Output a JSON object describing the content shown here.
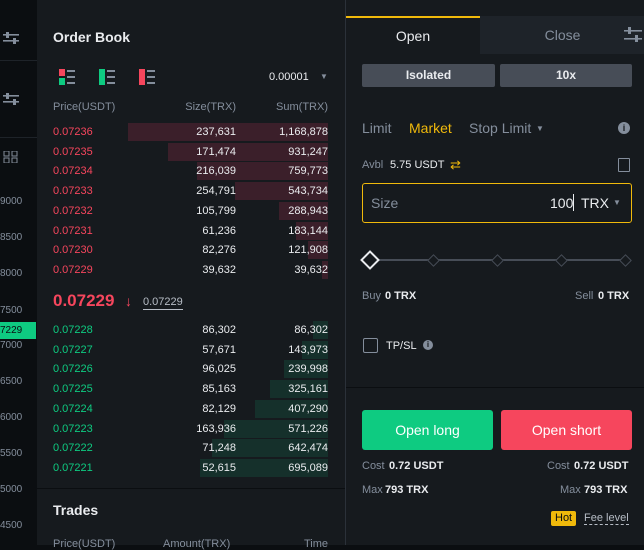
{
  "left_strip": {
    "ticks": [
      "9000",
      "8500",
      "8000",
      "7500",
      "7229",
      "7000",
      "6500",
      "6000",
      "5500",
      "5000",
      "4500"
    ],
    "highlight_color": "#0ecb81",
    "icons": [
      "sliders-icon",
      "sliders-icon",
      "grid-icon"
    ]
  },
  "order_book": {
    "title": "Order Book",
    "precision": "0.00001",
    "views": [
      "both-sides-view-icon",
      "bids-only-view-icon",
      "asks-only-view-icon"
    ],
    "columns": {
      "price": "Price(USDT)",
      "size": "Size(TRX)",
      "sum": "Sum(TRX)"
    },
    "asks": [
      {
        "price": "0.07236",
        "size": "237,631",
        "sum": "1,168,878",
        "depth": 0.69
      },
      {
        "price": "0.07235",
        "size": "171,474",
        "sum": "931,247",
        "depth": 0.55
      },
      {
        "price": "0.07234",
        "size": "216,039",
        "sum": "759,773",
        "depth": 0.45
      },
      {
        "price": "0.07233",
        "size": "254,791",
        "sum": "543,734",
        "depth": 0.32
      },
      {
        "price": "0.07232",
        "size": "105,799",
        "sum": "288,943",
        "depth": 0.17
      },
      {
        "price": "0.07231",
        "size": "61,236",
        "sum": "183,144",
        "depth": 0.11
      },
      {
        "price": "0.07230",
        "size": "82,276",
        "sum": "121,908",
        "depth": 0.07
      },
      {
        "price": "0.07229",
        "size": "39,632",
        "sum": "39,632",
        "depth": 0.02
      }
    ],
    "last_price": "0.07229",
    "mark_price": "0.07229",
    "bids": [
      {
        "price": "0.07228",
        "size": "86,302",
        "sum": "86,302",
        "depth": 0.05
      },
      {
        "price": "0.07227",
        "size": "57,671",
        "sum": "143,973",
        "depth": 0.09
      },
      {
        "price": "0.07226",
        "size": "96,025",
        "sum": "239,998",
        "depth": 0.15
      },
      {
        "price": "0.07225",
        "size": "85,163",
        "sum": "325,161",
        "depth": 0.2
      },
      {
        "price": "0.07224",
        "size": "82,129",
        "sum": "407,290",
        "depth": 0.25
      },
      {
        "price": "0.07223",
        "size": "163,936",
        "sum": "571,226",
        "depth": 0.36
      },
      {
        "price": "0.07222",
        "size": "71,248",
        "sum": "642,474",
        "depth": 0.4
      },
      {
        "price": "0.07221",
        "size": "52,615",
        "sum": "695,089",
        "depth": 0.44
      }
    ]
  },
  "trades": {
    "title": "Trades",
    "columns": {
      "price": "Price(USDT)",
      "amount": "Amount(TRX)",
      "time": "Time"
    }
  },
  "trade_panel": {
    "tabs": {
      "open": "Open",
      "close": "Close"
    },
    "margin_mode": "Isolated",
    "leverage": "10x",
    "order_types": {
      "limit": "Limit",
      "market": "Market",
      "stop": "Stop Limit"
    },
    "avbl_label": "Avbl",
    "avbl_value": "5.75 USDT",
    "size": {
      "label": "Size",
      "value": "100",
      "unit": "TRX"
    },
    "slider_level": 0,
    "buy_label": "Buy",
    "buy_value": "0 TRX",
    "sell_label": "Sell",
    "sell_value": "0 TRX",
    "tpsl": "TP/SL",
    "long_button": "Open long",
    "short_button": "Open short",
    "cost_label": "Cost",
    "long_cost": "0.72 USDT",
    "short_cost": "0.72 USDT",
    "max_label": "Max",
    "long_max": "793 TRX",
    "short_max": "793 TRX",
    "hot_badge": "Hot",
    "fee_level": "Fee level"
  },
  "colors": {
    "accent": "#f0b90b",
    "buy": "#0ecb81",
    "sell": "#f6465d"
  }
}
